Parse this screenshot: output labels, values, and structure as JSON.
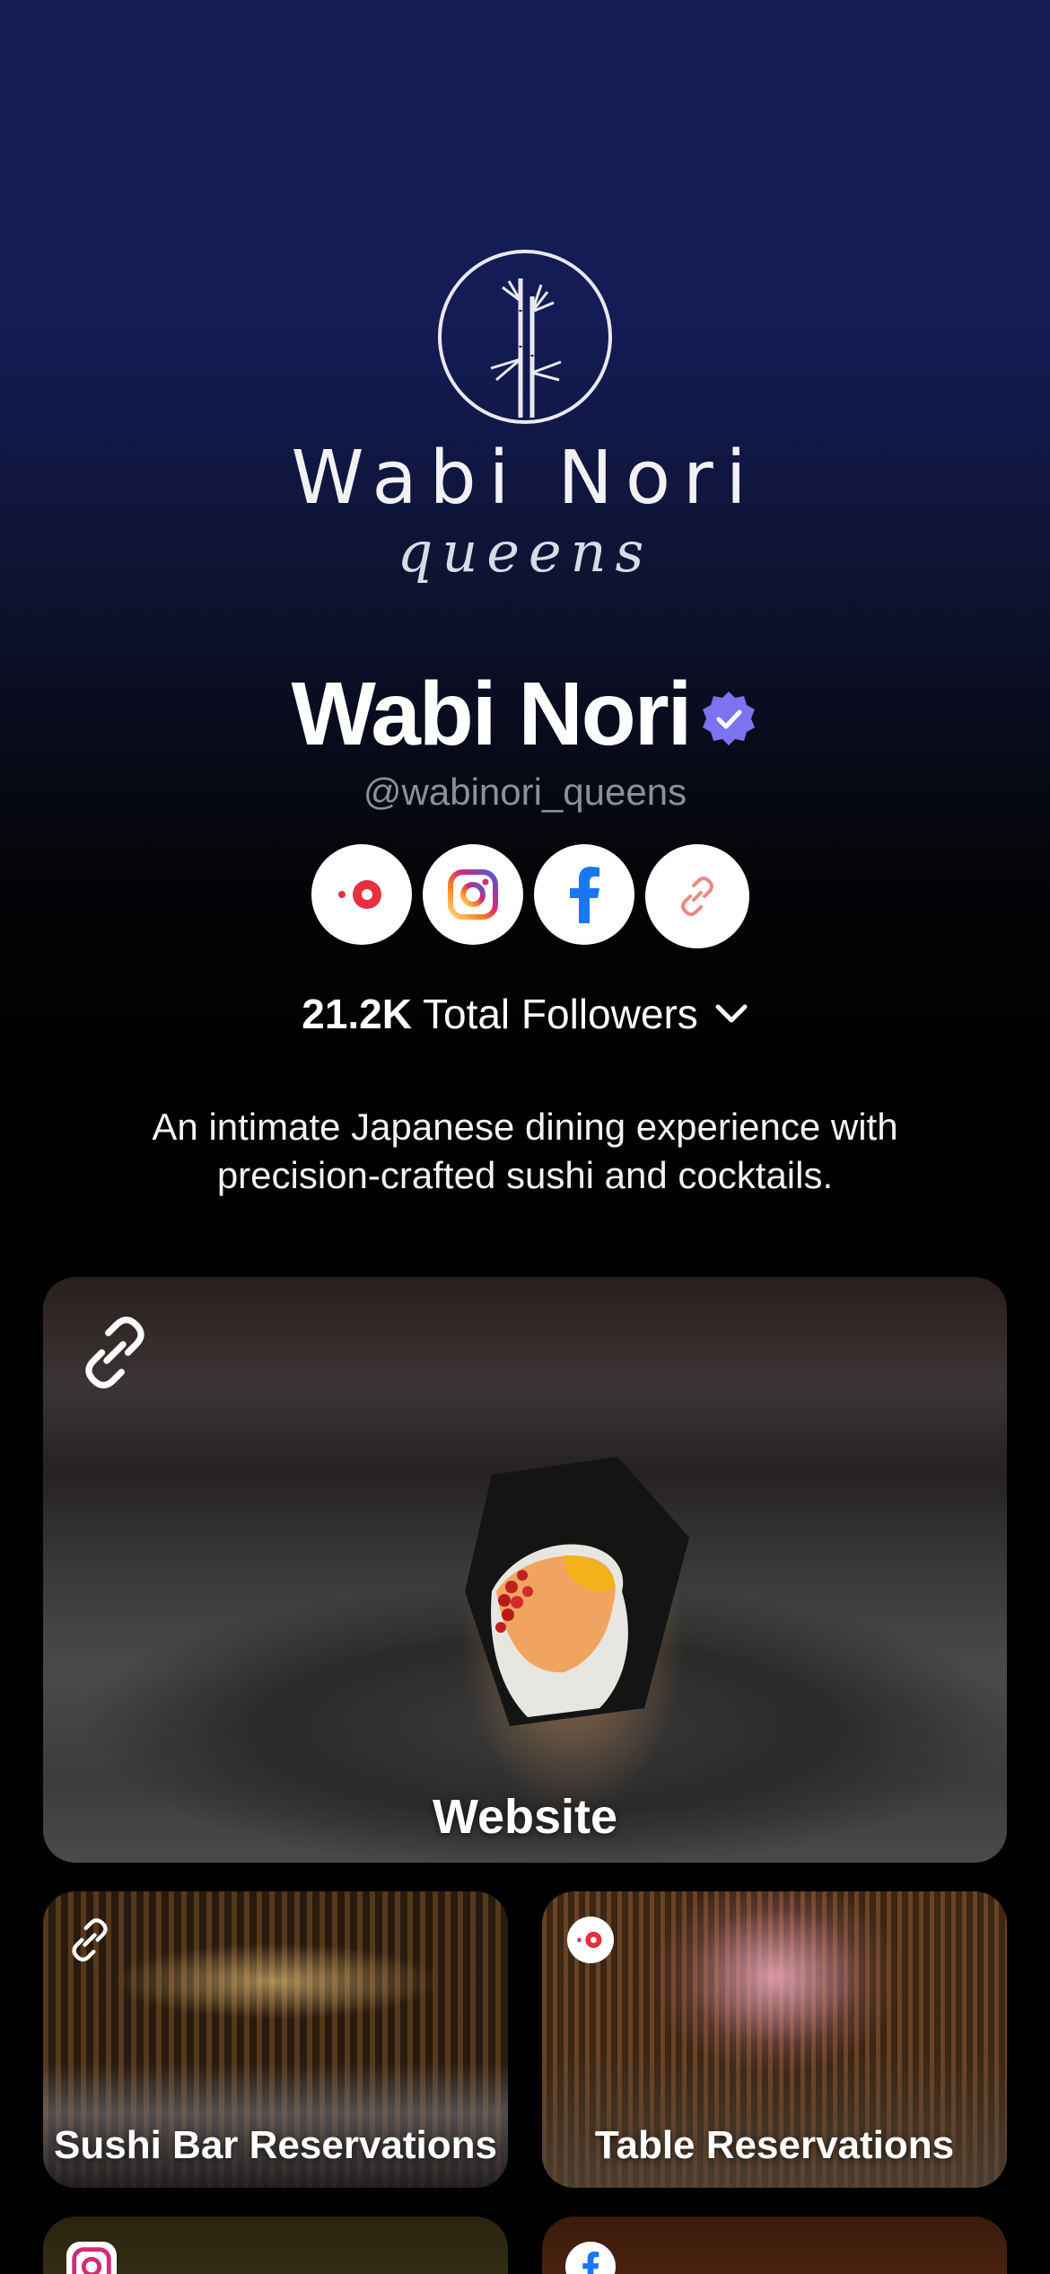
{
  "profile": {
    "logo_text": "Wabi Nori",
    "logo_subtext": "queens",
    "name": "Wabi Nori",
    "handle": "@wabinori_queens",
    "verified_icon": "verified-badge-icon",
    "verified_color": "#7b73f0"
  },
  "socials": [
    {
      "name": "reservation-platform",
      "icon": "reservation-icon",
      "color": "#e5303f"
    },
    {
      "name": "instagram",
      "icon": "instagram-icon",
      "color": "#d62976"
    },
    {
      "name": "facebook",
      "icon": "facebook-icon",
      "color": "#1877f2"
    },
    {
      "name": "website-link",
      "icon": "link-icon",
      "color": "#e98a80"
    }
  ],
  "followers": {
    "count": "21.2K",
    "label": "Total Followers",
    "icon": "chevron-down-icon"
  },
  "bio": "An intimate Japanese dining experience with precision-crafted sushi and cocktails.",
  "links": [
    {
      "label": "Website",
      "icon": "link-icon"
    },
    {
      "label": "Sushi Bar Reservations",
      "icon": "link-icon"
    },
    {
      "label": "Table Reservations",
      "icon": "reservation-icon"
    },
    {
      "label": "",
      "icon": "instagram-icon"
    },
    {
      "label": "",
      "icon": "facebook-icon"
    }
  ],
  "colors": {
    "background_top": "#141b55",
    "background_bottom": "#000000"
  }
}
